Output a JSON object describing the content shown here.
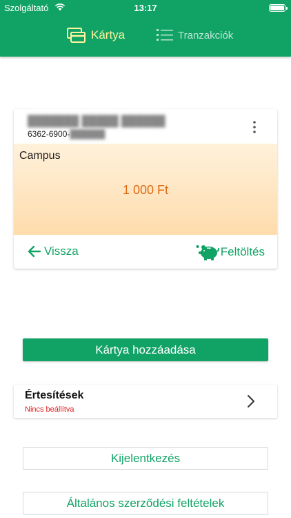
{
  "status_bar": {
    "carrier": "Szolgáltató",
    "time": "13:17"
  },
  "tabs": [
    {
      "label": "Kártya",
      "icon": "cards-icon",
      "active": true
    },
    {
      "label": "Tranzakciók",
      "icon": "list-icon",
      "active": false
    }
  ],
  "card": {
    "number_prefix": "6362-6900-",
    "type": "Campus",
    "balance": "1 000 Ft",
    "back_label": "Vissza",
    "topup_label": "Feltöltés"
  },
  "add_card_label": "Kártya hozzáadása",
  "notifications": {
    "title": "Értesítések",
    "status": "Nincs beállítva"
  },
  "logout_label": "Kijelentkezés",
  "terms_label": "Általános szerződési feltételek",
  "colors": {
    "brand": "#11a366",
    "active_tab": "#fff59d",
    "balance": "#e06a12",
    "warning": "#e21b1b"
  }
}
